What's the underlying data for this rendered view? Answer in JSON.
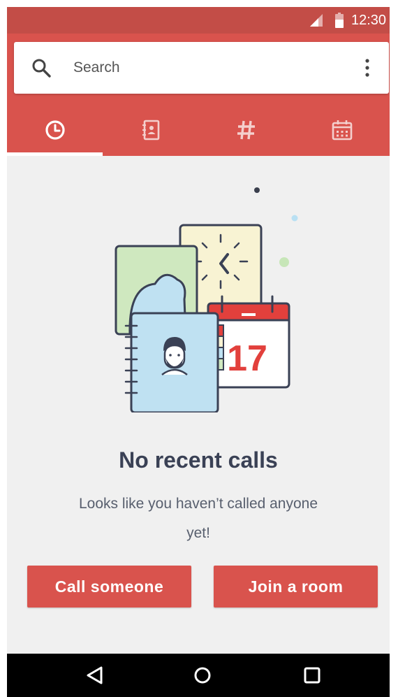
{
  "status_bar": {
    "time": "12:30",
    "icons": [
      "signal-icon",
      "battery-icon"
    ]
  },
  "search": {
    "placeholder": "Search",
    "value": "",
    "icon": "search-icon",
    "menu_icon": "more-vertical-icon"
  },
  "tabs": [
    {
      "id": "recents",
      "icon": "clock-icon",
      "active": true
    },
    {
      "id": "contacts",
      "icon": "contacts-book-icon",
      "active": false
    },
    {
      "id": "dialpad",
      "icon": "hash-icon",
      "active": false
    },
    {
      "id": "calendar",
      "icon": "calendar-icon",
      "active": false
    }
  ],
  "empty_state": {
    "calendar_day": "17",
    "title": "No recent calls",
    "subtitle": "Looks like you haven’t called anyone yet!"
  },
  "actions": {
    "call_label": "Call someone",
    "join_label": "Join a room"
  },
  "nav_bar": {
    "icons": [
      "back-icon",
      "home-icon",
      "recents-icon"
    ]
  },
  "colors": {
    "status_bar": "#c34d47",
    "primary": "#d9534d",
    "background": "#f0f0f0",
    "title_text": "#3a4155",
    "body_text": "#585f6e"
  }
}
